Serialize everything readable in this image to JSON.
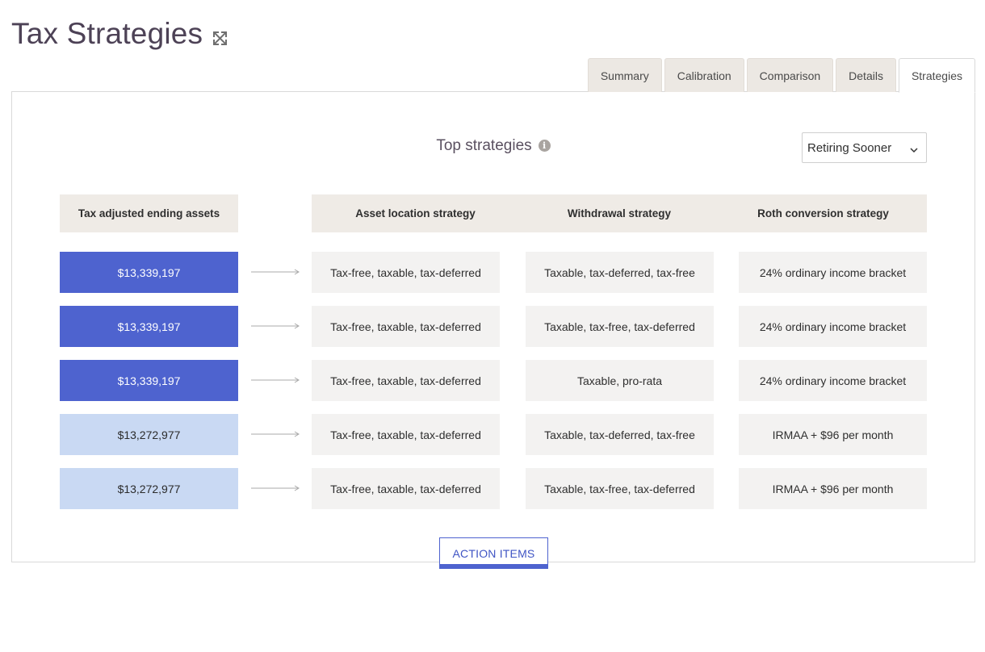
{
  "page": {
    "title": "Tax Strategies",
    "expand_icon": "expand-arrows-icon"
  },
  "tabs": [
    {
      "label": "Summary",
      "active": false
    },
    {
      "label": "Calibration",
      "active": false
    },
    {
      "label": "Comparison",
      "active": false
    },
    {
      "label": "Details",
      "active": false
    },
    {
      "label": "Strategies",
      "active": true
    }
  ],
  "strategies": {
    "title": "Top strategies",
    "info_icon": "info-icon",
    "scenario_select": {
      "value": "Retiring Sooner"
    },
    "headers": {
      "assets": "Tax adjusted ending assets",
      "asset_location": "Asset location strategy",
      "withdrawal": "Withdrawal strategy",
      "roth": "Roth conversion strategy"
    },
    "rows": [
      {
        "assets": "$13,339,197",
        "asset_location": "Tax-free, taxable, tax-deferred",
        "withdrawal": "Taxable, tax-deferred, tax-free",
        "roth": "24% ordinary income bracket",
        "highlight": "dark"
      },
      {
        "assets": "$13,339,197",
        "asset_location": "Tax-free, taxable, tax-deferred",
        "withdrawal": "Taxable, tax-free, tax-deferred",
        "roth": "24% ordinary income bracket",
        "highlight": "dark"
      },
      {
        "assets": "$13,339,197",
        "asset_location": "Tax-free, taxable, tax-deferred",
        "withdrawal": "Taxable, pro-rata",
        "roth": "24% ordinary income bracket",
        "highlight": "dark"
      },
      {
        "assets": "$13,272,977",
        "asset_location": "Tax-free, taxable, tax-deferred",
        "withdrawal": "Taxable, tax-deferred, tax-free",
        "roth": "IRMAA + $96 per month",
        "highlight": "light"
      },
      {
        "assets": "$13,272,977",
        "asset_location": "Tax-free, taxable, tax-deferred",
        "withdrawal": "Taxable, tax-free, tax-deferred",
        "roth": "IRMAA + $96 per month",
        "highlight": "light"
      }
    ],
    "action_button": "ACTION ITEMS"
  },
  "colors": {
    "accent": "#4e63cf",
    "accent_light": "#c9d9f3",
    "title": "#4d4256"
  }
}
